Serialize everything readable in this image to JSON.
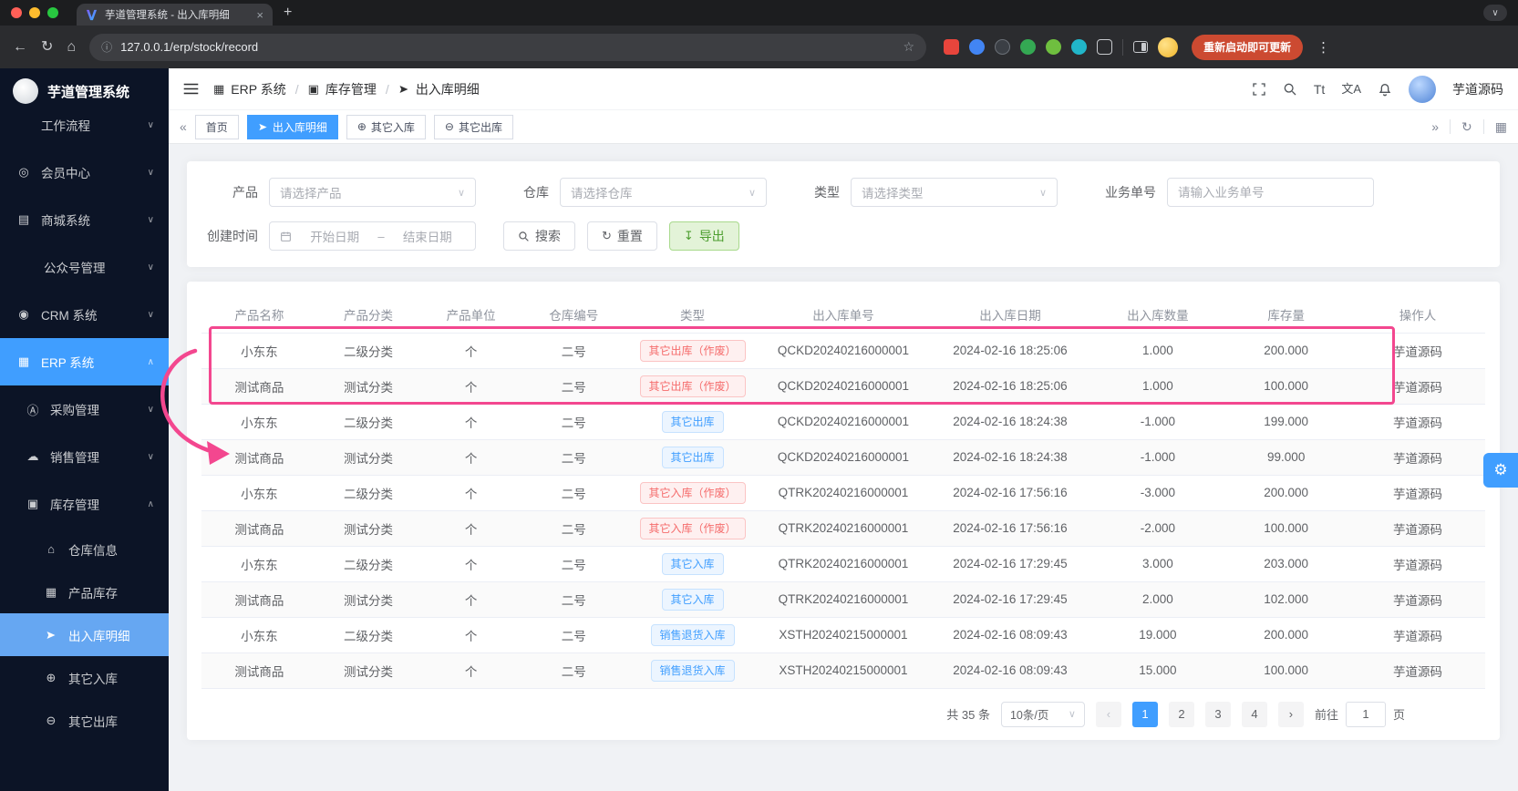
{
  "browser": {
    "tab_title": "芋道管理系统 - 出入库明细",
    "url": "127.0.0.1/erp/stock/record",
    "update_button_label": "重新启动即可更新"
  },
  "icons": {
    "close": "×",
    "plus": "+",
    "chevron_down": "∨",
    "chevron_up": "∧",
    "back": "←",
    "refresh": "↻",
    "home": "⌂",
    "info": "ⓘ",
    "star": "☆",
    "more": "⋮",
    "member": "◎",
    "mall": "▤",
    "crm": "◉",
    "erp": "▦",
    "purchase": "Ⓐ",
    "sales": "☁",
    "stock": "▣",
    "house": "⌂",
    "product": "▦",
    "other_in": "⊕",
    "other_out": "⊖",
    "collapse_left": "«",
    "collapse_right": "»",
    "grid": "▦",
    "font_size": "Tt",
    "translate": "文A",
    "export": "↧",
    "prev": "‹",
    "next": "›",
    "gear": "⚙"
  },
  "sidebar": {
    "app_title": "芋道管理系统",
    "items": [
      {
        "label": "工作流程"
      },
      {
        "label": "会员中心"
      },
      {
        "label": "商城系统"
      },
      {
        "label": "公众号管理"
      },
      {
        "label": "CRM 系统"
      },
      {
        "label": "ERP 系统"
      },
      {
        "label": "采购管理"
      },
      {
        "label": "销售管理"
      },
      {
        "label": "库存管理"
      },
      {
        "label": "仓库信息"
      },
      {
        "label": "产品库存"
      },
      {
        "label": "出入库明细"
      },
      {
        "label": "其它入库"
      },
      {
        "label": "其它出库"
      }
    ]
  },
  "header": {
    "separator": "/",
    "breadcrumb": [
      {
        "label": "ERP 系统"
      },
      {
        "label": "库存管理"
      },
      {
        "label": "出入库明细"
      }
    ],
    "username": "芋道源码"
  },
  "tabs": {
    "items": [
      {
        "label": "首页"
      },
      {
        "label": "出入库明细"
      },
      {
        "label": "其它入库"
      },
      {
        "label": "其它出库"
      }
    ]
  },
  "filters": {
    "product": {
      "label": "产品",
      "placeholder": "请选择产品"
    },
    "warehouse": {
      "label": "仓库",
      "placeholder": "请选择仓库"
    },
    "type": {
      "label": "类型",
      "placeholder": "请选择类型"
    },
    "biz_no": {
      "label": "业务单号",
      "placeholder": "请输入业务单号"
    },
    "create_time": {
      "label": "创建时间",
      "start_placeholder": "开始日期",
      "separator": "–",
      "end_placeholder": "结束日期"
    },
    "search_label": "搜索",
    "reset_label": "重置",
    "export_label": "导出"
  },
  "table": {
    "columns": [
      "产品名称",
      "产品分类",
      "产品单位",
      "仓库编号",
      "类型",
      "出入库单号",
      "出入库日期",
      "出入库数量",
      "库存量",
      "操作人"
    ],
    "rows": [
      {
        "name": "小东东",
        "category": "二级分类",
        "unit": "个",
        "warehouse": "二号",
        "type": "其它出库（作废）",
        "type_style": "danger",
        "order_no": "QCKD20240216000001",
        "date": "2024-02-16 18:25:06",
        "qty": "1.000",
        "stock": "200.000",
        "operator": "芋道源码"
      },
      {
        "name": "测试商品",
        "category": "测试分类",
        "unit": "个",
        "warehouse": "二号",
        "type": "其它出库（作废）",
        "type_style": "danger",
        "order_no": "QCKD20240216000001",
        "date": "2024-02-16 18:25:06",
        "qty": "1.000",
        "stock": "100.000",
        "operator": "芋道源码"
      },
      {
        "name": "小东东",
        "category": "二级分类",
        "unit": "个",
        "warehouse": "二号",
        "type": "其它出库",
        "type_style": "primary",
        "order_no": "QCKD20240216000001",
        "date": "2024-02-16 18:24:38",
        "qty": "-1.000",
        "stock": "199.000",
        "operator": "芋道源码"
      },
      {
        "name": "测试商品",
        "category": "测试分类",
        "unit": "个",
        "warehouse": "二号",
        "type": "其它出库",
        "type_style": "primary",
        "order_no": "QCKD20240216000001",
        "date": "2024-02-16 18:24:38",
        "qty": "-1.000",
        "stock": "99.000",
        "operator": "芋道源码"
      },
      {
        "name": "小东东",
        "category": "二级分类",
        "unit": "个",
        "warehouse": "二号",
        "type": "其它入库（作废）",
        "type_style": "danger",
        "order_no": "QTRK20240216000001",
        "date": "2024-02-16 17:56:16",
        "qty": "-3.000",
        "stock": "200.000",
        "operator": "芋道源码"
      },
      {
        "name": "测试商品",
        "category": "测试分类",
        "unit": "个",
        "warehouse": "二号",
        "type": "其它入库（作废）",
        "type_style": "danger",
        "order_no": "QTRK20240216000001",
        "date": "2024-02-16 17:56:16",
        "qty": "-2.000",
        "stock": "100.000",
        "operator": "芋道源码"
      },
      {
        "name": "小东东",
        "category": "二级分类",
        "unit": "个",
        "warehouse": "二号",
        "type": "其它入库",
        "type_style": "primary",
        "order_no": "QTRK20240216000001",
        "date": "2024-02-16 17:29:45",
        "qty": "3.000",
        "stock": "203.000",
        "operator": "芋道源码"
      },
      {
        "name": "测试商品",
        "category": "测试分类",
        "unit": "个",
        "warehouse": "二号",
        "type": "其它入库",
        "type_style": "primary",
        "order_no": "QTRK20240216000001",
        "date": "2024-02-16 17:29:45",
        "qty": "2.000",
        "stock": "102.000",
        "operator": "芋道源码"
      },
      {
        "name": "小东东",
        "category": "二级分类",
        "unit": "个",
        "warehouse": "二号",
        "type": "销售退货入库",
        "type_style": "primary",
        "order_no": "XSTH20240215000001",
        "date": "2024-02-16 08:09:43",
        "qty": "19.000",
        "stock": "200.000",
        "operator": "芋道源码"
      },
      {
        "name": "测试商品",
        "category": "测试分类",
        "unit": "个",
        "warehouse": "二号",
        "type": "销售退货入库",
        "type_style": "primary",
        "order_no": "XSTH20240215000001",
        "date": "2024-02-16 08:09:43",
        "qty": "15.000",
        "stock": "100.000",
        "operator": "芋道源码"
      }
    ]
  },
  "pagination": {
    "total_text": "共 35 条",
    "page_size_text": "10条/页",
    "pages": [
      "1",
      "2",
      "3",
      "4"
    ],
    "goto_label": "前往",
    "goto_value": "1",
    "unit_label": "页"
  }
}
